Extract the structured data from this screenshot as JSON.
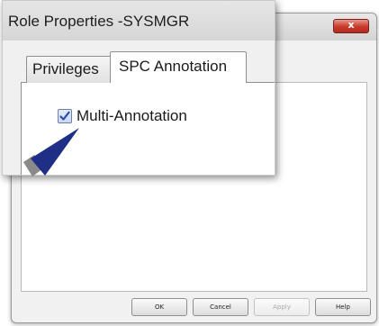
{
  "window": {
    "title": "Role Properties -SYSMGR",
    "close_glyph": "x"
  },
  "tabs": [
    {
      "label": "Privileges",
      "selected": false
    },
    {
      "label": "SPC Annotation",
      "selected": true
    }
  ],
  "options": {
    "multi_annotation": {
      "label": "Multi-Annotation",
      "checked": true
    }
  },
  "buttons": {
    "ok": "OK",
    "cancel": "Cancel",
    "apply": "Apply",
    "help": "Help"
  },
  "colors": {
    "close_button": "#c63a2c",
    "checkmark": "#2b4fa8",
    "pointer_arrow": "#1f2f86",
    "pointer_tail": "#8a8a8a"
  },
  "icons": {
    "close": "close-icon",
    "checkmark": "checkmark-icon",
    "pointer": "arrow-pointer-icon"
  }
}
